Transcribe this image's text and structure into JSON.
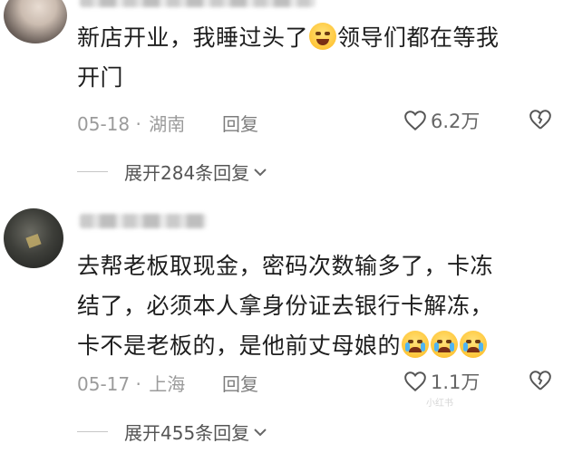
{
  "comments": [
    {
      "lines": [
        "新店开业，我睡过头了",
        "领导们都在等我",
        "开门"
      ],
      "date": "05-18",
      "location": "湖南",
      "reply_label": "回复",
      "likes": "6.2万",
      "expand_label": "展开284条回复"
    },
    {
      "lines": [
        "去帮老板取现金，密码次数输多了，卡冻",
        "结了，必须本人拿身份证去银行卡解冻，",
        "卡不是老板的，是他前丈母娘的"
      ],
      "date": "05-17",
      "location": "上海",
      "reply_label": "回复",
      "likes": "1.1万",
      "expand_label": "展开455条回复"
    }
  ],
  "watermark": "小红书",
  "colors": {
    "meta": "#9b9b9b",
    "text": "#1e1e1e",
    "icon": "#666666"
  },
  "icons": [
    "heart-outline-icon",
    "broken-heart-icon",
    "chevron-down-icon",
    "laughing-tears-emoji",
    "crying-emoji"
  ]
}
